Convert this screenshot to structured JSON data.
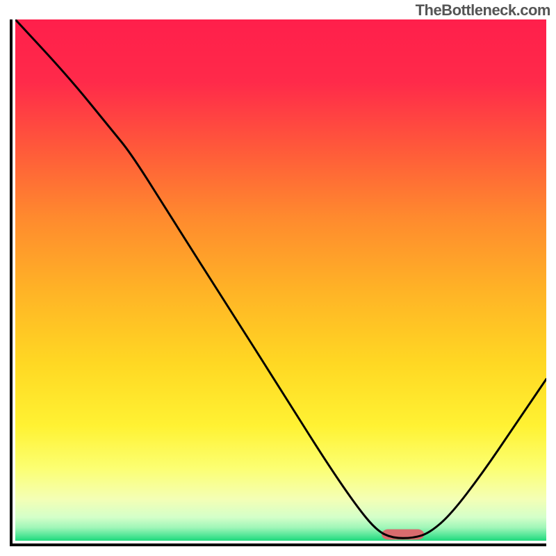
{
  "watermark": "TheBottleneck.com",
  "chart_data": {
    "type": "line",
    "title": "",
    "xlabel": "",
    "ylabel": "",
    "xlim": [
      0,
      100
    ],
    "ylim": [
      0,
      100
    ],
    "grid": false,
    "legend": false,
    "gradient_stops": [
      {
        "offset": 0.0,
        "color": "#ff1f4b"
      },
      {
        "offset": 0.12,
        "color": "#ff2a4a"
      },
      {
        "offset": 0.25,
        "color": "#ff5a3a"
      },
      {
        "offset": 0.38,
        "color": "#ff8a2e"
      },
      {
        "offset": 0.52,
        "color": "#ffb326"
      },
      {
        "offset": 0.66,
        "color": "#ffd823"
      },
      {
        "offset": 0.78,
        "color": "#fff233"
      },
      {
        "offset": 0.86,
        "color": "#fcff71"
      },
      {
        "offset": 0.92,
        "color": "#f4ffb5"
      },
      {
        "offset": 0.955,
        "color": "#d4ffc9"
      },
      {
        "offset": 0.975,
        "color": "#9ff6b8"
      },
      {
        "offset": 0.99,
        "color": "#52e697"
      },
      {
        "offset": 1.0,
        "color": "#1ed97d"
      }
    ],
    "series": [
      {
        "name": "bottleneck-curve",
        "stroke": "#000000",
        "stroke_width": 3,
        "points": [
          {
            "x": 0,
            "y": 100
          },
          {
            "x": 10,
            "y": 89
          },
          {
            "x": 18,
            "y": 79
          },
          {
            "x": 22,
            "y": 74
          },
          {
            "x": 30,
            "y": 61
          },
          {
            "x": 40,
            "y": 45
          },
          {
            "x": 50,
            "y": 29
          },
          {
            "x": 58,
            "y": 16
          },
          {
            "x": 64,
            "y": 7
          },
          {
            "x": 68,
            "y": 2
          },
          {
            "x": 71,
            "y": 0.5
          },
          {
            "x": 75,
            "y": 0.5
          },
          {
            "x": 78,
            "y": 1.5
          },
          {
            "x": 82,
            "y": 5
          },
          {
            "x": 88,
            "y": 13
          },
          {
            "x": 94,
            "y": 22
          },
          {
            "x": 100,
            "y": 31
          }
        ]
      }
    ],
    "markers": [
      {
        "name": "optimal-bar",
        "type": "bar",
        "x_center": 73,
        "width": 8,
        "y": 1.2,
        "height": 2,
        "color": "#d96b6e",
        "rx": 1.2
      }
    ]
  }
}
